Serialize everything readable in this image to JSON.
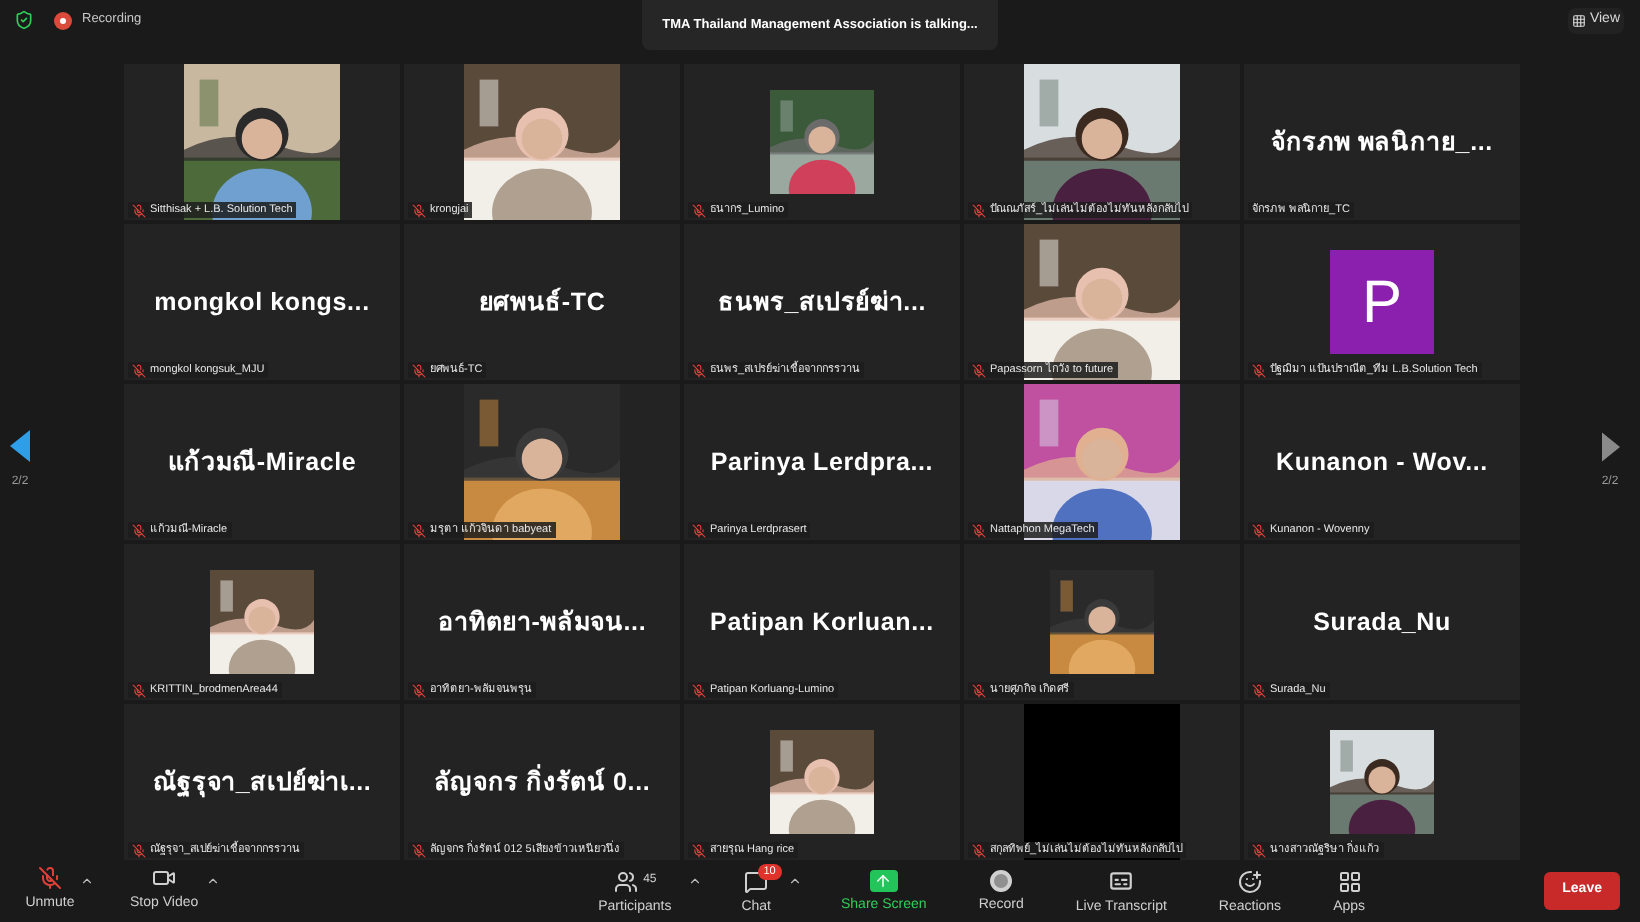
{
  "top_bar": {
    "recording": "Recording",
    "speaker_banner": "TMA Thailand Management Association is talking...",
    "view_button": "View"
  },
  "pager": {
    "left": "2/2",
    "right": "2/2"
  },
  "tiles": [
    {
      "label": "Sitthisak + L.B. Solution Tech",
      "muted": true
    },
    {
      "label": "krongjai",
      "muted": true
    },
    {
      "kind": "thumb",
      "label": "ธนากร_Lumino",
      "muted": true
    },
    {
      "label": "ปัณณภัสร์_ไม่เล่นไม่ต้องไม่ทันหลังกลับไป",
      "muted": true
    },
    {
      "kind": "name",
      "display_name": "จักรภพ พลนิกาย_...",
      "label": "จักรภพ พลนิกาย_TC",
      "muted": false
    },
    {
      "kind": "name",
      "display_name": "mongkol kongs...",
      "label": "mongkol kongsuk_MJU",
      "muted": true
    },
    {
      "kind": "name",
      "display_name": "ยศพนธ์-TC",
      "label": "ยศพนธ์-TC",
      "muted": true
    },
    {
      "kind": "name",
      "display_name": "ธนพร_สเปรย์ฆ่า...",
      "label": "ธนพร_สเปรย์ฆ่าเชื้อจากกรรวาน",
      "muted": true
    },
    {
      "label": "Papassorn ไกวัง to future",
      "muted": true
    },
    {
      "kind": "avatar",
      "letter": "P",
      "color": "#8b1fae",
      "label": "ปัฐฌิมา แป้นปราณีต_ทีม L.B.Solution Tech",
      "muted": true
    },
    {
      "kind": "name",
      "display_name": "แก้วมณี-Miracle",
      "label": "แก้วมณี-Miracle",
      "muted": true
    },
    {
      "label": "มรุตา แก้วจินดา babyeat",
      "muted": true
    },
    {
      "kind": "name",
      "display_name": "Parinya Lerdpra...",
      "label": "Parinya Lerdprasert",
      "muted": true
    },
    {
      "label": "Nattaphon MegaTech",
      "muted": true
    },
    {
      "kind": "name",
      "display_name": "Kunanon - Wov...",
      "label": "Kunanon - Wovenny",
      "muted": true
    },
    {
      "kind": "thumb",
      "label": "KRITTIN_brodmenArea44",
      "muted": true
    },
    {
      "kind": "name",
      "display_name": "อาทิตยา-พลัมจน...",
      "label": "อาทิตยา-พลัมจนพรุน",
      "muted": true
    },
    {
      "kind": "name",
      "display_name": "Patipan Korluan...",
      "label": "Patipan Korluang-Lumino",
      "muted": true
    },
    {
      "kind": "thumb",
      "label": "นายศุภกิจ เกิดศรี",
      "muted": true
    },
    {
      "kind": "name",
      "display_name": "Surada_Nu",
      "label": "Surada_Nu",
      "muted": true
    },
    {
      "kind": "name",
      "display_name": "ณัฐรุจา_สเปย์ฆ่าเ...",
      "label": "ณัฐรุจา_สเปย์ฆ่าเชื้อจากกรรวาน",
      "muted": true
    },
    {
      "kind": "name",
      "display_name": "ลัญจกร กิ่งรัตน์ 0...",
      "label": "ลัญจกร กิ่งรัตน์ 012 5เสียงข้าวเหนียวนึ่ง",
      "muted": true
    },
    {
      "kind": "thumb",
      "label": "สายรุณ Hang rice",
      "muted": true
    },
    {
      "kind": "blank",
      "label": "สกุลทิพย์_ไม่เล่นไม่ต้องไม่ทันหลังกลับไป",
      "muted": true
    },
    {
      "kind": "thumb",
      "label": "นางสาวณัฐริษา กิ่งแก้ว",
      "muted": true
    }
  ],
  "toolbar": {
    "audio": {
      "label": "Unmute",
      "muted": true
    },
    "video": {
      "label": "Stop Video"
    },
    "buttons": [
      {
        "kind": "participants",
        "label": "Participants",
        "count": "45"
      },
      {
        "kind": "chat",
        "label": "Chat",
        "badge": "10"
      },
      {
        "kind": "share",
        "label": "Share Screen"
      },
      {
        "kind": "record",
        "label": "Record"
      },
      {
        "kind": "transcript",
        "label": "Live Transcript"
      },
      {
        "kind": "reactions",
        "label": "Reactions"
      },
      {
        "kind": "apps",
        "label": "Apps"
      }
    ],
    "leave": "Leave"
  }
}
